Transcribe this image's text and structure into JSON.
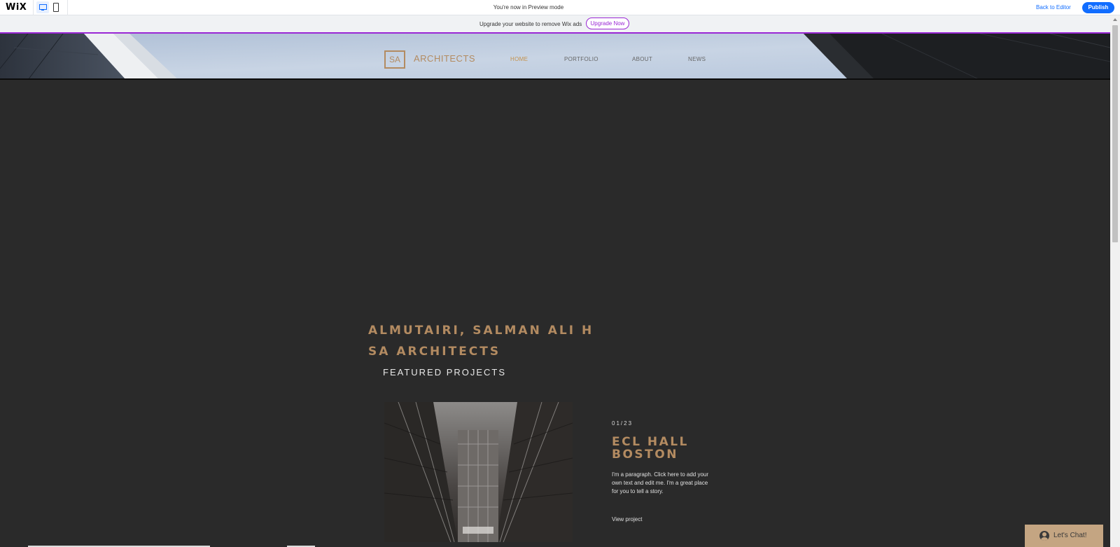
{
  "topbar": {
    "logo": "WiX",
    "preview_message": "You're now in Preview mode",
    "back_to_editor": "Back to Editor",
    "publish": "Publish"
  },
  "banner": {
    "text": "Upgrade your website to remove Wix ads",
    "upgrade_button": "Upgrade Now"
  },
  "site_header": {
    "logo_initials": "SA",
    "logo_text": "ARCHITECTS",
    "nav": [
      {
        "label": "HOME",
        "active": true
      },
      {
        "label": "PORTFOLIO",
        "active": false
      },
      {
        "label": "ABOUT",
        "active": false
      },
      {
        "label": "NEWS",
        "active": false
      }
    ]
  },
  "main": {
    "title_line1": "ALMUTAIRI, SALMAN ALI H",
    "title_line2": "SA ARCHITECTS",
    "featured": "FEATURED PROJECTS"
  },
  "project": {
    "count": "01/23",
    "title_line1": "ECL HALL",
    "title_line2": "BOSTON",
    "description": "I'm a paragraph. Click here to add your own text and edit me. I'm a great place for you to tell a story.",
    "link": "View project"
  },
  "chat": {
    "label": "Let's Chat!"
  },
  "colors": {
    "accent": "#b38b61",
    "background": "#2a2a2a",
    "wix_blue": "#116dff",
    "wix_purple": "#9a27d5",
    "chat_bg": "#c4a582"
  }
}
